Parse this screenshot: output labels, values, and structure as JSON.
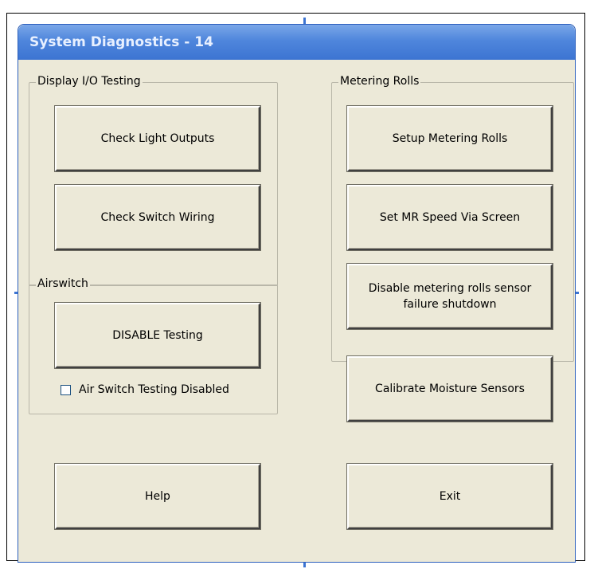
{
  "window": {
    "title": "System Diagnostics - 14"
  },
  "display_io": {
    "legend": "Display I/O Testing",
    "check_light_outputs": "Check Light Outputs",
    "check_switch_wiring": "Check Switch Wiring"
  },
  "airswitch": {
    "legend": "Airswitch",
    "disable_testing": "DISABLE Testing",
    "checkbox_label": "Air Switch Testing Disabled",
    "checkbox_checked": false
  },
  "metering_rolls": {
    "legend": "Metering Rolls",
    "setup": "Setup Metering Rolls",
    "set_speed": "Set MR Speed Via Screen",
    "disable_line1": "Disable metering rolls sensor",
    "disable_line2": "failure shutdown"
  },
  "actions": {
    "calibrate": "Calibrate Moisture Sensors",
    "help": "Help",
    "exit": "Exit"
  }
}
